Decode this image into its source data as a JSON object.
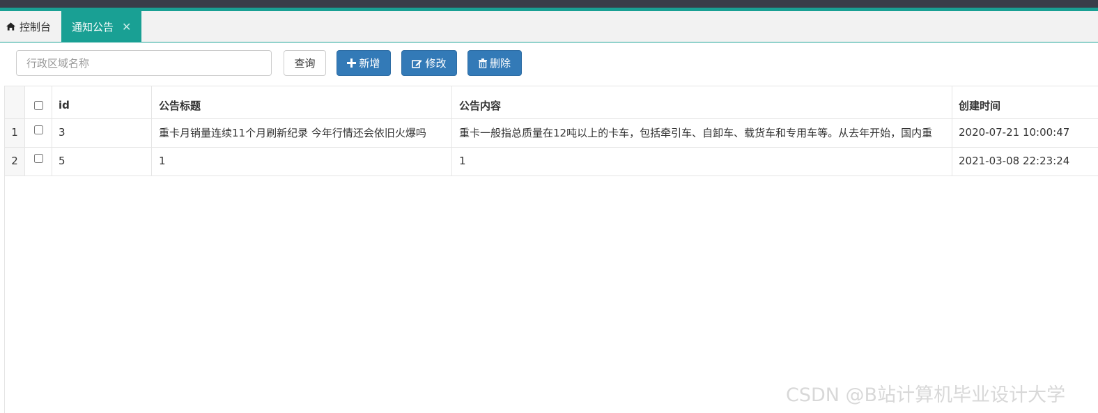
{
  "tabs": {
    "home_label": "控制台",
    "active_label": "通知公告",
    "close_symbol": "✕"
  },
  "toolbar": {
    "search_placeholder": "行政区域名称",
    "query_label": "查询",
    "add_label": "新增",
    "edit_label": "修改",
    "delete_label": "删除"
  },
  "table": {
    "columns": [
      "id",
      "公告标题",
      "公告内容",
      "创建时间"
    ],
    "rows": [
      {
        "rownum": "1",
        "id": "3",
        "title": "重卡月销量连续11个月刷新纪录 今年行情还会依旧火爆吗",
        "content": "重卡一般指总质量在12吨以上的卡车，包括牵引车、自卸车、载货车和专用车等。从去年开始，国内重",
        "created": "2020-07-21 10:00:47"
      },
      {
        "rownum": "2",
        "id": "5",
        "title": "1",
        "content": "1",
        "created": "2021-03-08 22:23:24"
      }
    ]
  },
  "watermark": "CSDN @B站计算机毕业设计大学",
  "colors": {
    "accent": "#19a094",
    "primary_button": "#337ab7",
    "header_dark": "#393d49"
  }
}
